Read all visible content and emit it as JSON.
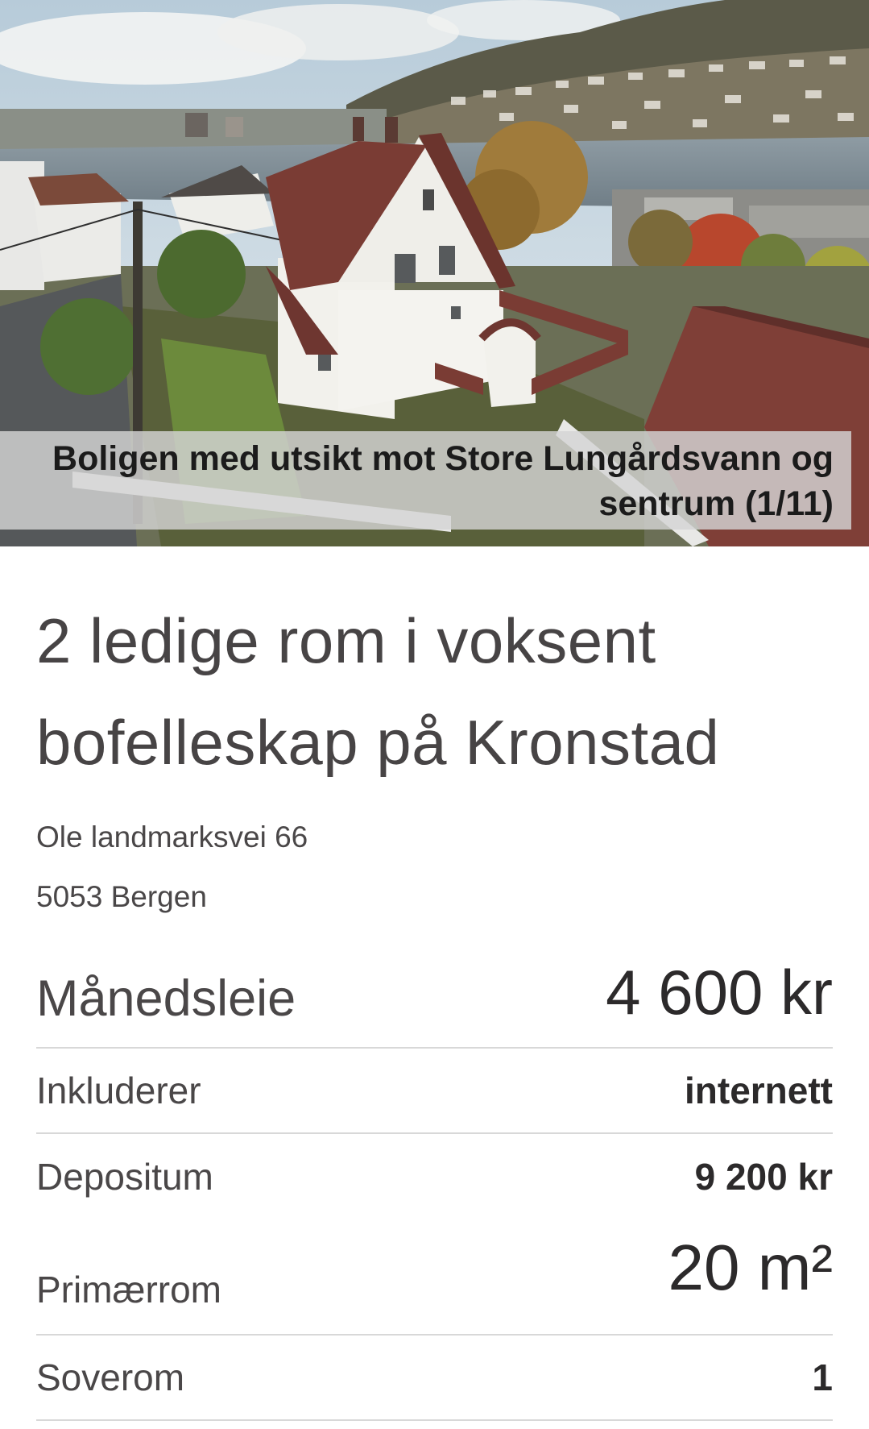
{
  "listing": {
    "image": {
      "caption": "Boligen med utsikt mot Store Lungårdsvann og sentrum (1/11)"
    },
    "title": "2 ledige rom  i voksent bofelleskap på Kronstad",
    "address": {
      "street": "Ole landmarksvei 66",
      "city": "5053 Bergen"
    },
    "facts": {
      "rent_label": "Månedsleie",
      "rent_value": "4 600 kr",
      "includes_label": "Inkluderer",
      "includes_value": "internett",
      "deposit_label": "Depositum",
      "deposit_value": "9 200 kr",
      "area_label": "Primærrom",
      "area_value": "20 m²",
      "bedrooms_label": "Soverom",
      "bedrooms_value": "1"
    }
  }
}
